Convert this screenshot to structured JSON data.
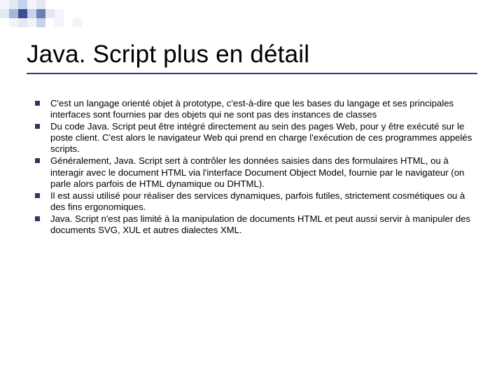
{
  "title": "Java. Script plus en détail",
  "bullets": [
    "C'est un langage orienté objet à prototype, c'est-à-dire que les bases du langage et ses principales interfaces sont fournies par des objets qui ne sont pas des instances de classes",
    "Du code Java. Script peut être intégré directement au sein des pages Web, pour y être exécuté sur le poste client. C'est alors le navigateur Web qui prend en charge l'exécution de ces programmes appelés scripts.",
    "Généralement, Java. Script sert à contrôler les données saisies dans des formulaires HTML, ou à interagir avec le document HTML via l'interface Document Object Model, fournie par le navigateur (on parle alors parfois de HTML dynamique ou DHTML).",
    "Il est aussi utilisé pour réaliser des services dynamiques, parfois futiles, strictement cosmétiques ou à des fins ergonomiques.",
    "Java. Script n'est pas limité à la manipulation de documents HTML et peut aussi servir à manipuler des documents SVG, XUL et autres dialectes XML."
  ]
}
